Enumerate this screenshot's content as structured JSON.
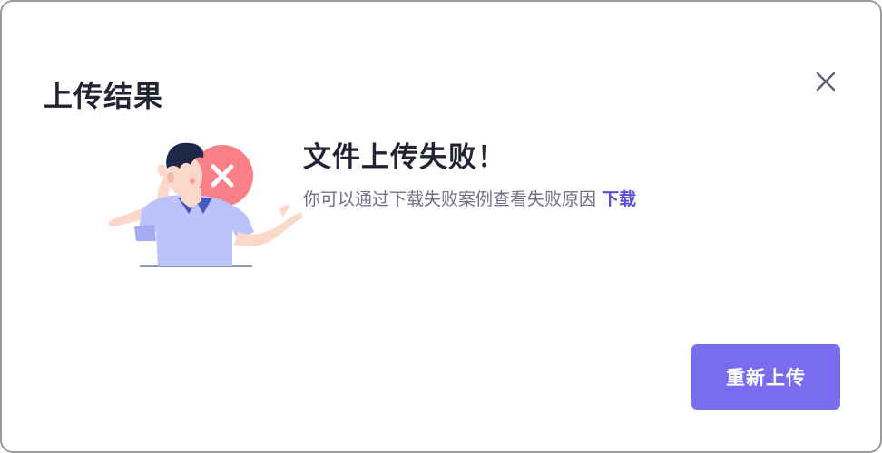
{
  "dialog": {
    "title": "上传结果"
  },
  "result": {
    "status": "failed",
    "title": "文件上传失败！",
    "description": "你可以通过下载失败案例查看失败原因",
    "download_label": "下载"
  },
  "actions": {
    "reupload_label": "重新上传"
  },
  "icons": {
    "close": "close-icon",
    "illustration": "upload-failed-illustration"
  },
  "colors": {
    "accent": "#7a6cf0",
    "link": "#5b4fdc",
    "error": "#fa7f86",
    "title_text": "#222433",
    "muted_text": "#6e7088"
  }
}
